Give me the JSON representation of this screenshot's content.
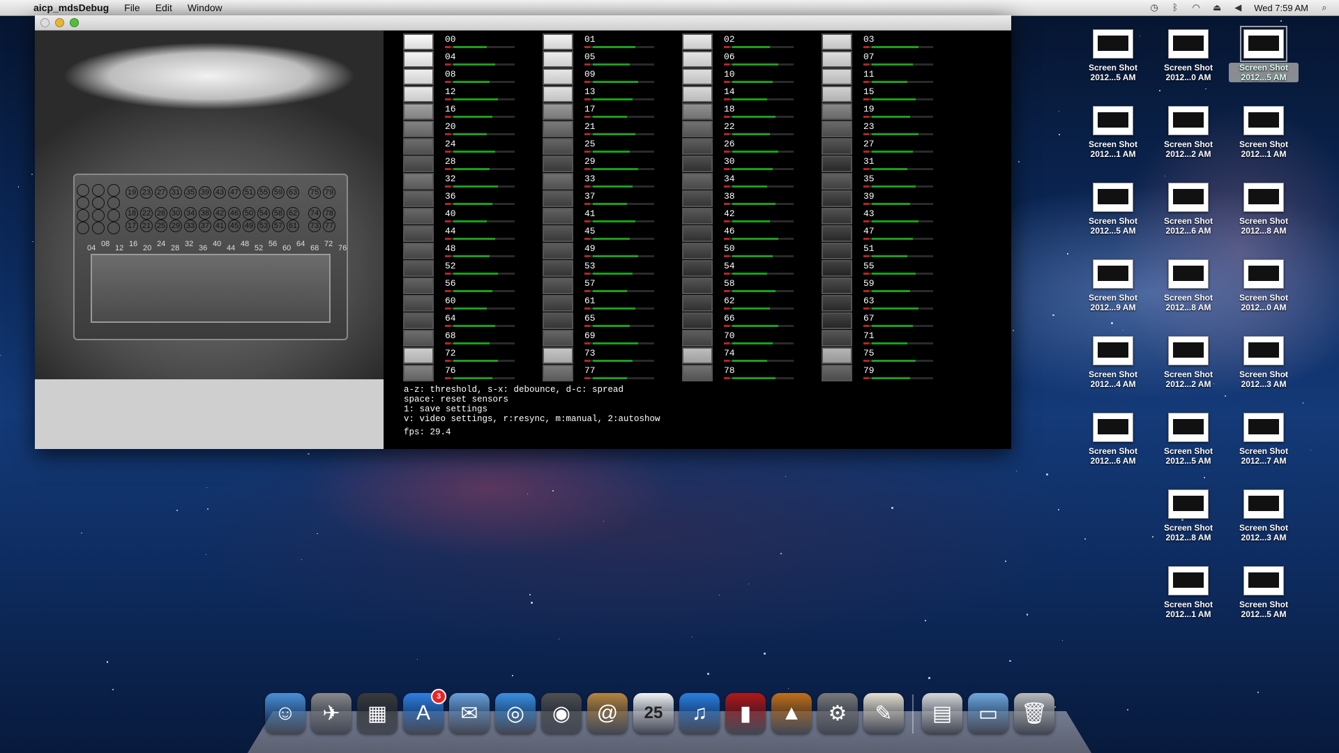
{
  "menubar": {
    "app_name": "aicp_mdsDebug",
    "items": [
      "File",
      "Edit",
      "Window"
    ],
    "clock": "Wed 7:59 AM",
    "tray_icons": [
      "time-machine-icon",
      "bluetooth-icon",
      "wifi-icon",
      "eject-icon",
      "volume-icon"
    ]
  },
  "camera": {
    "circle_labels": [
      "19",
      "23",
      "27",
      "31",
      "35",
      "39",
      "43",
      "47",
      "51",
      "55",
      "59",
      "63",
      "75",
      "79",
      "18",
      "22",
      "26",
      "30",
      "34",
      "38",
      "42",
      "46",
      "50",
      "54",
      "58",
      "62",
      "74",
      "78",
      "17",
      "21",
      "25",
      "29",
      "33",
      "37",
      "41",
      "45",
      "49",
      "53",
      "57",
      "61",
      "73",
      "77"
    ],
    "bottom_numbers": [
      "04",
      "08",
      "12",
      "16",
      "20",
      "24",
      "28",
      "32",
      "36",
      "40",
      "44",
      "48",
      "52",
      "56",
      "60",
      "64",
      "68",
      "72",
      "76"
    ]
  },
  "sensors": {
    "labels": [
      "00",
      "01",
      "02",
      "03",
      "04",
      "05",
      "06",
      "07",
      "08",
      "09",
      "10",
      "11",
      "12",
      "13",
      "14",
      "15",
      "16",
      "17",
      "18",
      "19",
      "20",
      "21",
      "22",
      "23",
      "24",
      "25",
      "26",
      "27",
      "28",
      "29",
      "30",
      "31",
      "32",
      "33",
      "34",
      "35",
      "36",
      "37",
      "38",
      "39",
      "40",
      "41",
      "42",
      "43",
      "44",
      "45",
      "46",
      "47",
      "48",
      "49",
      "50",
      "51",
      "52",
      "53",
      "54",
      "55",
      "56",
      "57",
      "58",
      "59",
      "60",
      "61",
      "62",
      "63",
      "64",
      "65",
      "66",
      "67",
      "68",
      "69",
      "70",
      "71",
      "72",
      "73",
      "74",
      "75",
      "76",
      "77",
      "78",
      "79"
    ]
  },
  "help": {
    "lines": [
      "a-z: threshold, s-x: debounce, d-c: spread",
      "space: reset sensors",
      "1: save settings",
      "v: video settings, r:resync, m:manual, 2:autoshow"
    ],
    "fps": "fps: 29.4"
  },
  "desktop_icons": [
    {
      "label1": "Screen Shot",
      "label2": "2012...5 AM"
    },
    {
      "label1": "Screen Shot",
      "label2": "2012...0 AM"
    },
    {
      "label1": "Screen Shot",
      "label2": "2012...5 AM",
      "selected": true
    },
    {
      "label1": "Screen Shot",
      "label2": "2012...1 AM"
    },
    {
      "label1": "Screen Shot",
      "label2": "2012...2 AM"
    },
    {
      "label1": "Screen Shot",
      "label2": "2012...1 AM"
    },
    {
      "label1": "Screen Shot",
      "label2": "2012...5 AM"
    },
    {
      "label1": "Screen Shot",
      "label2": "2012...6 AM"
    },
    {
      "label1": "Screen Shot",
      "label2": "2012...8 AM"
    },
    {
      "label1": "Screen Shot",
      "label2": "2012...9 AM"
    },
    {
      "label1": "Screen Shot",
      "label2": "2012...8 AM"
    },
    {
      "label1": "Screen Shot",
      "label2": "2012...0 AM"
    },
    {
      "label1": "Screen Shot",
      "label2": "2012...4 AM"
    },
    {
      "label1": "Screen Shot",
      "label2": "2012...2 AM"
    },
    {
      "label1": "Screen Shot",
      "label2": "2012...3 AM"
    },
    {
      "label1": "Screen Shot",
      "label2": "2012...6 AM"
    },
    {
      "label1": "Screen Shot",
      "label2": "2012...5 AM"
    },
    {
      "label1": "Screen Shot",
      "label2": "2012...7 AM"
    },
    {
      "label1": "Screen Shot",
      "label2": "2012...8 AM"
    },
    {
      "label1": "Screen Shot",
      "label2": "2012...3 AM"
    },
    {
      "label1": "Screen Shot",
      "label2": "2012...1 AM"
    },
    {
      "label1": "Screen Shot",
      "label2": "2012...5 AM"
    }
  ],
  "dock": {
    "apps": [
      {
        "name": "finder-icon",
        "color": "#4a8fd6",
        "glyph": "☺"
      },
      {
        "name": "launchpad-icon",
        "color": "#8a8a8a",
        "glyph": "✈"
      },
      {
        "name": "mission-control-icon",
        "color": "#3a3a3a",
        "glyph": "▦"
      },
      {
        "name": "app-store-icon",
        "color": "#2f7fe0",
        "glyph": "A",
        "badge": "3"
      },
      {
        "name": "mail-icon",
        "color": "#6aa0d8",
        "glyph": "✉"
      },
      {
        "name": "safari-icon",
        "color": "#3b8fe0",
        "glyph": "◎"
      },
      {
        "name": "facetime-icon",
        "color": "#505050",
        "glyph": "◉"
      },
      {
        "name": "address-book-icon",
        "color": "#b48640",
        "glyph": "@"
      },
      {
        "name": "calendar-icon",
        "color": "#f2f2f2",
        "glyph": "25"
      },
      {
        "name": "itunes-icon",
        "color": "#2a7fe0",
        "glyph": "♫"
      },
      {
        "name": "photo-booth-icon",
        "color": "#b01818",
        "glyph": "▮"
      },
      {
        "name": "iphoto-icon",
        "color": "#c0701a",
        "glyph": "▲"
      },
      {
        "name": "system-preferences-icon",
        "color": "#7a7a7a",
        "glyph": "⚙"
      },
      {
        "name": "textedit-icon",
        "color": "#e8e0d0",
        "glyph": "✎"
      }
    ],
    "right": [
      {
        "name": "documents-stack-icon",
        "color": "#d8d8d8",
        "glyph": "▤"
      },
      {
        "name": "downloads-folder-icon",
        "color": "#6fa8dc",
        "glyph": "▭"
      },
      {
        "name": "trash-icon",
        "color": "#bbbbbb",
        "glyph": "🗑"
      }
    ]
  },
  "colors": {
    "accent_bar": "#1aa01a",
    "mark": "#b22222"
  }
}
